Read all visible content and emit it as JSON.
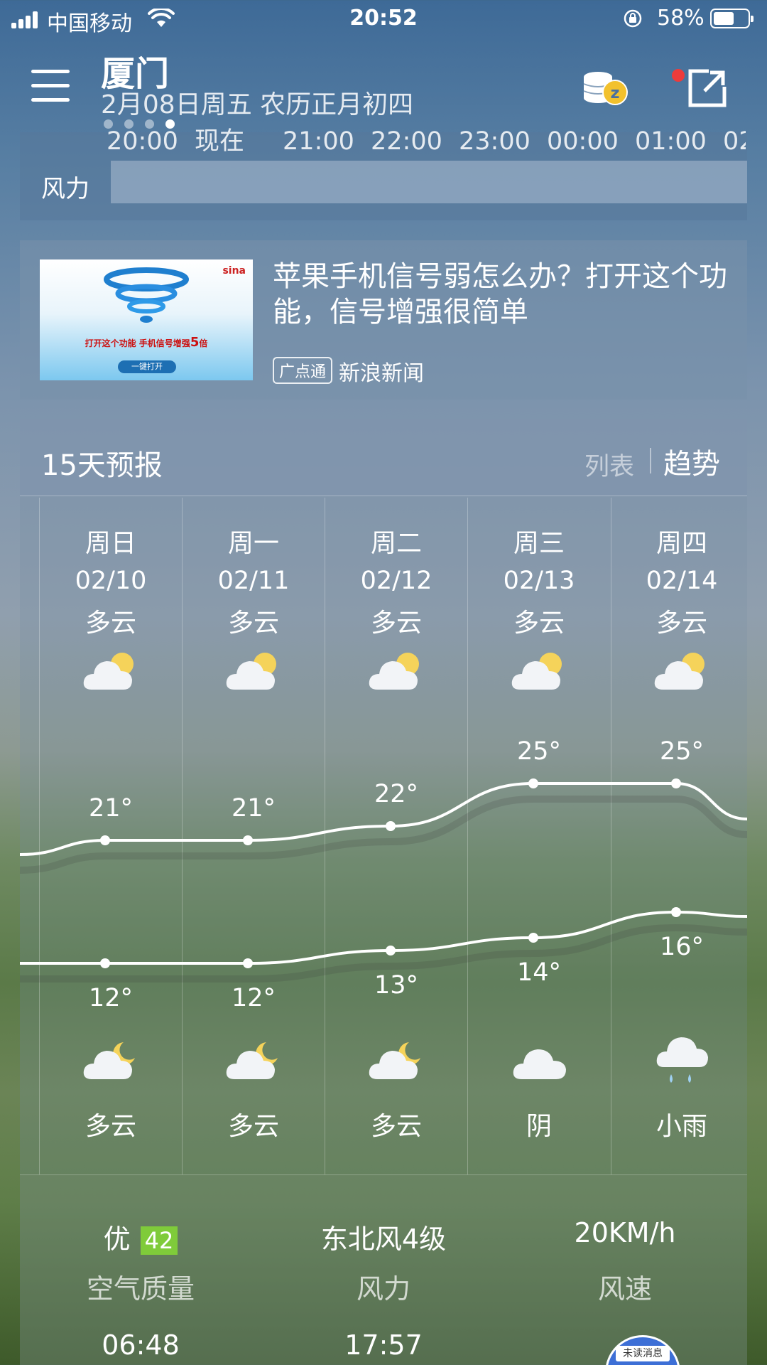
{
  "status_bar": {
    "carrier": "中国移动",
    "time": "20:52",
    "battery": "58%"
  },
  "header": {
    "city": "厦门",
    "date": "2月08日周五 农历正月初四",
    "page_dots": 4,
    "active_dot": 3
  },
  "hourly": {
    "hours": [
      "20:00",
      "现在",
      "21:00",
      "22:00",
      "23:00",
      "00:00",
      "01:00",
      "02"
    ],
    "wind_label": "风力"
  },
  "ad": {
    "title": "苹果手机信号弱怎么办？打开这个功能，信号增强很简单",
    "tag": "广点通",
    "source": "新浪新闻",
    "image_brand": "sina",
    "image_text_pre": "打开这个功能 手机信号增强",
    "image_text_num": "5",
    "image_text_post": "倍",
    "image_button": "一键打开"
  },
  "forecast": {
    "title": "15天预报",
    "view_list": "列表",
    "view_trend": "趋势",
    "days": [
      {
        "day": "周日",
        "date": "02/10",
        "day_weather": "多云",
        "day_icon": "partly-cloudy-day-icon",
        "high": "21°",
        "low": "12°",
        "night_icon": "partly-cloudy-night-icon",
        "night_weather": "多云"
      },
      {
        "day": "周一",
        "date": "02/11",
        "day_weather": "多云",
        "day_icon": "partly-cloudy-day-icon",
        "high": "21°",
        "low": "12°",
        "night_icon": "partly-cloudy-night-icon",
        "night_weather": "多云"
      },
      {
        "day": "周二",
        "date": "02/12",
        "day_weather": "多云",
        "day_icon": "partly-cloudy-day-icon",
        "high": "22°",
        "low": "13°",
        "night_icon": "partly-cloudy-night-icon",
        "night_weather": "多云"
      },
      {
        "day": "周三",
        "date": "02/13",
        "day_weather": "多云",
        "day_icon": "partly-cloudy-day-icon",
        "high": "25°",
        "low": "14°",
        "night_icon": "cloudy-icon",
        "night_weather": "阴"
      },
      {
        "day": "周四",
        "date": "02/14",
        "day_weather": "多云",
        "day_icon": "partly-cloudy-day-icon",
        "high": "25°",
        "low": "16°",
        "night_icon": "light-rain-icon",
        "night_weather": "小雨"
      }
    ],
    "high_values": [
      21,
      21,
      22,
      25,
      25
    ],
    "low_values": [
      12,
      12,
      13,
      14,
      16
    ]
  },
  "details": {
    "aqi_text": "优",
    "aqi_value": "42",
    "aqi_label": "空气质量",
    "wind_dir": "东北风4级",
    "wind_label": "风力",
    "wind_speed": "20KM/h",
    "speed_label": "风速",
    "sunrise": "06:48",
    "sunset": "17:57",
    "unread": "未读消息"
  },
  "colors": {
    "aqi_badge": "#7fcb3a",
    "notify_dot": "#ee3b3b",
    "coin": "#f2c12e"
  }
}
